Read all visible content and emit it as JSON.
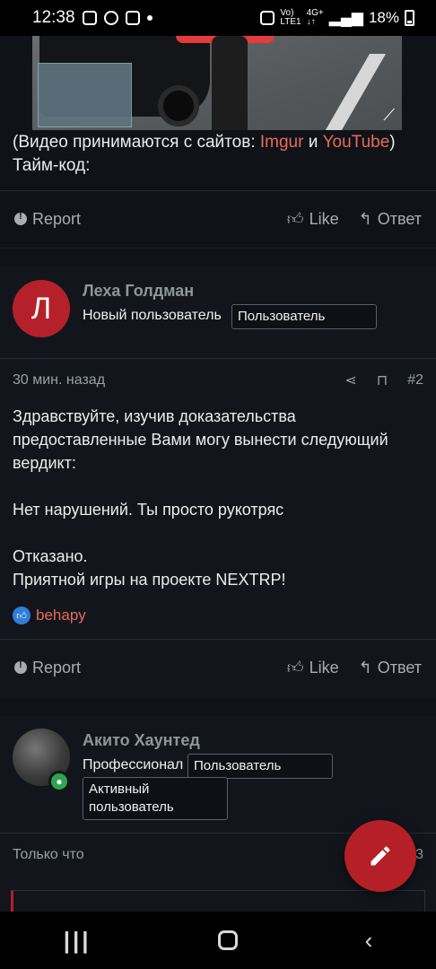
{
  "status_bar": {
    "time": "12:38",
    "battery": "18%",
    "net_top": "Vo)",
    "net_bottom": "LTE1",
    "net2_top": "4G+",
    "net2_bottom": "↓↑"
  },
  "post1": {
    "text_before": "(Видео принимаются с сайтов: ",
    "link1": "Imgur",
    "text_mid": " и ",
    "link2": "YouTube",
    "text_after": ")",
    "timecode_label": "Тайм-код:"
  },
  "actions": {
    "report": "Report",
    "like": "Like",
    "reply": "Ответ"
  },
  "post2": {
    "avatar_letter": "Л",
    "author": "Леха Голдман",
    "role": "Новый пользователь",
    "badge": "Пользователь",
    "time": "30 мин. назад",
    "number": "#2",
    "line1": "Здравствуйте, изучив доказательства",
    "line2": "предоставленные Вами могу вынести следующий",
    "line3": "вердикт:",
    "line4": "Нет нарушений. Ты просто рукотряс",
    "line5": "Отказано.",
    "line6": "Приятной игры на проекте NEXTRP!",
    "reaction_user": "behapy"
  },
  "post3": {
    "author": "Акито Хаунтед",
    "role": "Профессионал",
    "badge1": "Пользователь",
    "badge2_line1": "Активный",
    "badge2_line2": "пользователь",
    "time": "Только что",
    "number_partial": "3"
  },
  "colors": {
    "accent": "#b51f27",
    "link": "#e86a5a",
    "bg": "#12161c"
  }
}
